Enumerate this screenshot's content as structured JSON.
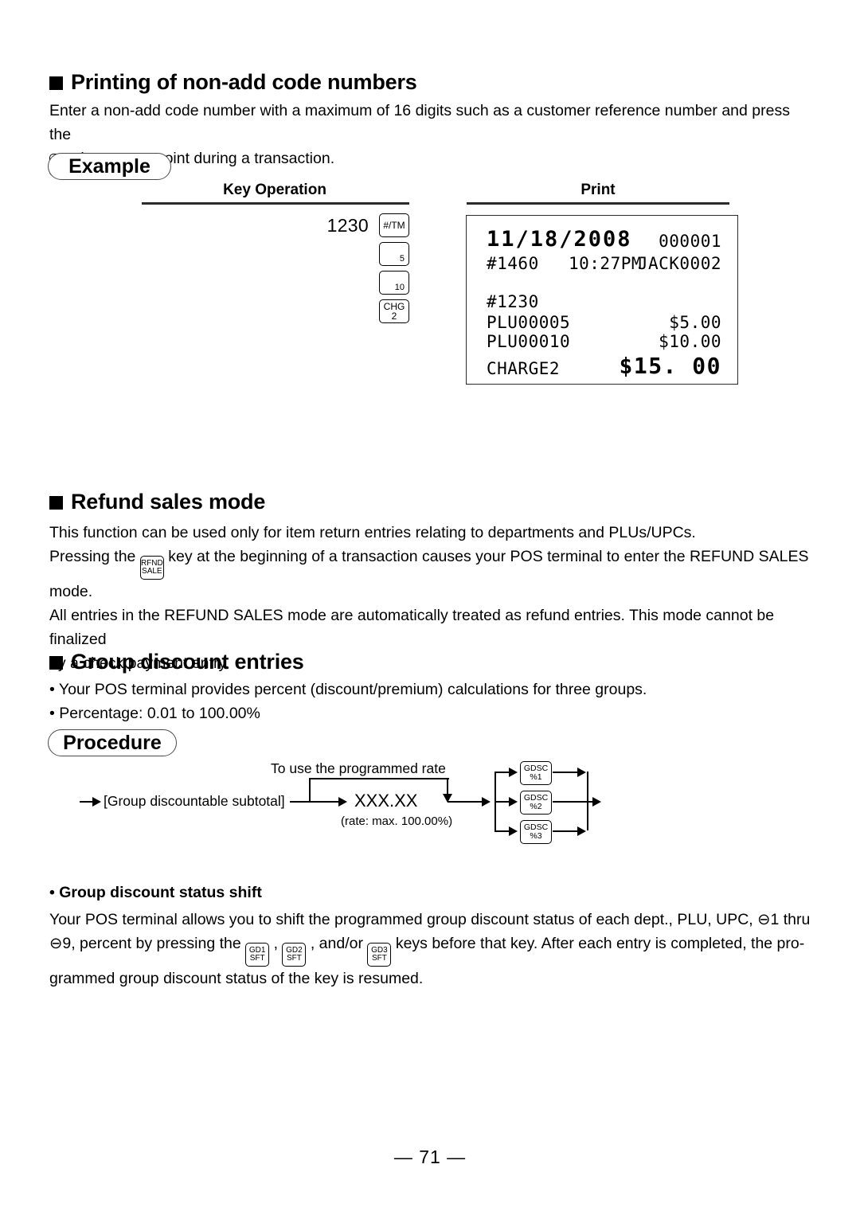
{
  "page": {
    "number_label": "— 71 —"
  },
  "sections": {
    "non_add_code": {
      "heading": "Printing of non-add code numbers",
      "paragraph_part1": "Enter a non-add code number with a maximum of 16 digits such as a customer reference number and press the",
      "inline_key": {
        "line1": "#/TM"
      },
      "paragraph_part2": "key at any point during a transaction."
    },
    "refund_sales": {
      "heading": "Refund sales mode",
      "line1": "This function can be used only for item return entries relating to departments and PLUs/UPCs.",
      "line2_part1": "Pressing the",
      "inline_key": {
        "line1": "RFND",
        "line2": "SALE"
      },
      "line2_part2": "key at the beginning of a transaction causes your POS terminal to enter the REFUND SALES",
      "line3": "mode.",
      "line4": "All entries in the REFUND SALES mode are automatically treated as refund entries. This mode cannot be finalized",
      "line5": "by a check payment entry."
    },
    "group_discount": {
      "heading": "Group discount entries",
      "bullet1": "• Your POS terminal provides percent (discount/premium) calculations for three groups.",
      "bullet2": "• Percentage: 0.01 to 100.00%"
    },
    "group_discount_status_shift": {
      "heading": "• Group discount status shift",
      "line1_part1": "Your POS terminal allows you to shift the programmed group discount status of each dept., PLU, UPC,",
      "line1_circle": "⊖",
      "line1_part2": "1 thru",
      "line2_circle": "⊖",
      "line2_part1": "9, percent by pressing the",
      "key1": {
        "line1": "GD1",
        "line2": "SFT"
      },
      "sep1": ",",
      "key2": {
        "line1": "GD2",
        "line2": "SFT"
      },
      "sep2": ", and/or",
      "key3": {
        "line1": "GD3",
        "line2": "SFT"
      },
      "line2_part2": "keys before that key. After each entry is completed, the pro-",
      "line3": "grammed group discount status of the key is resumed."
    }
  },
  "badges": {
    "example": "Example",
    "procedure": "Procedure"
  },
  "example_table": {
    "col_key_operation": "Key Operation",
    "col_print": "Print",
    "key_operation": {
      "entry_value": "1230",
      "keys": [
        {
          "line1": "#/TM",
          "line2": "",
          "style": "center"
        },
        {
          "line1": "",
          "line2": "5",
          "style": "numright"
        },
        {
          "line1": "",
          "line2": "10",
          "style": "numright"
        },
        {
          "line1": "CHG",
          "line2": "2",
          "style": "center"
        }
      ]
    },
    "receipt": {
      "date": "11/18/2008",
      "counter": "000001",
      "register_no": "#1460",
      "time": "10:27PM",
      "clerk": "JACK0002",
      "non_add_code": "#1230",
      "items": [
        {
          "name": "PLU00005",
          "amount": "$5.00"
        },
        {
          "name": "PLU00010",
          "amount": "$10.00"
        }
      ],
      "total_label": "CHARGE2",
      "total_amount": "$15. 00"
    }
  },
  "procedure_diagram": {
    "bypass_label": "To use the programmed rate",
    "subtotal_label": "[Group discountable subtotal]",
    "rate_value": "XXX.XX",
    "rate_note": "(rate: max. 100.00%)",
    "keys": [
      {
        "line1": "GDSC",
        "line2": "%1"
      },
      {
        "line1": "GDSC",
        "line2": "%2"
      },
      {
        "line1": "GDSC",
        "line2": "%3"
      }
    ]
  }
}
